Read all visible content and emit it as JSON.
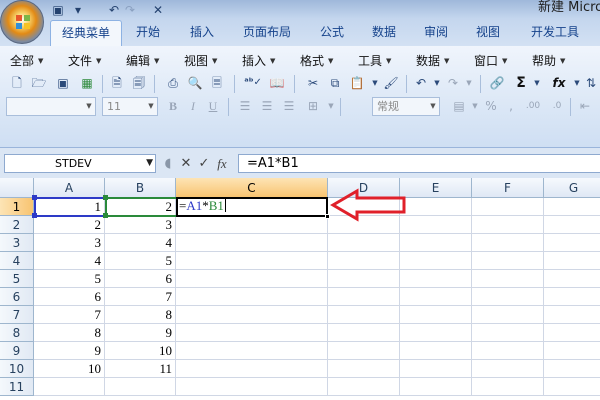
{
  "window": {
    "title": "新建 Micro"
  },
  "tabs": [
    {
      "label": "经典菜单",
      "active": true
    },
    {
      "label": "开始"
    },
    {
      "label": "插入"
    },
    {
      "label": "页面布局"
    },
    {
      "label": "公式"
    },
    {
      "label": "数据"
    },
    {
      "label": "审阅"
    },
    {
      "label": "视图"
    },
    {
      "label": "开发工具"
    }
  ],
  "menus": [
    "全部",
    "文件",
    "编辑",
    "视图",
    "插入",
    "格式",
    "工具",
    "数据",
    "窗口",
    "帮助"
  ],
  "toolbar": {
    "font_size": "11",
    "number_format": "常规",
    "sum_glyph": "Σ",
    "function_glyph": "fx"
  },
  "formula_bar": {
    "name_box": "STDEV",
    "cancel_glyph": "✕",
    "enter_glyph": "✓",
    "fx_label": "fx",
    "formula": "=A1*B1"
  },
  "sheet": {
    "columns": [
      "A",
      "B",
      "C",
      "D",
      "E",
      "F",
      "G"
    ],
    "rows": [
      "1",
      "2",
      "3",
      "4",
      "5",
      "6",
      "7",
      "8",
      "9",
      "10",
      "11"
    ],
    "col_a": [
      "1",
      "2",
      "3",
      "4",
      "5",
      "6",
      "7",
      "8",
      "9",
      "10"
    ],
    "col_b": [
      "2",
      "3",
      "4",
      "5",
      "6",
      "7",
      "8",
      "9",
      "10",
      "11"
    ],
    "active_cell": {
      "ref": "C1",
      "parts": [
        "=",
        "A1",
        "*",
        "B1"
      ],
      "ref_colors": {
        "A1": "#2d3ac7",
        "B1": "#2a8a3a"
      }
    }
  },
  "annotation": {
    "arrow_color": "#e0202a"
  }
}
